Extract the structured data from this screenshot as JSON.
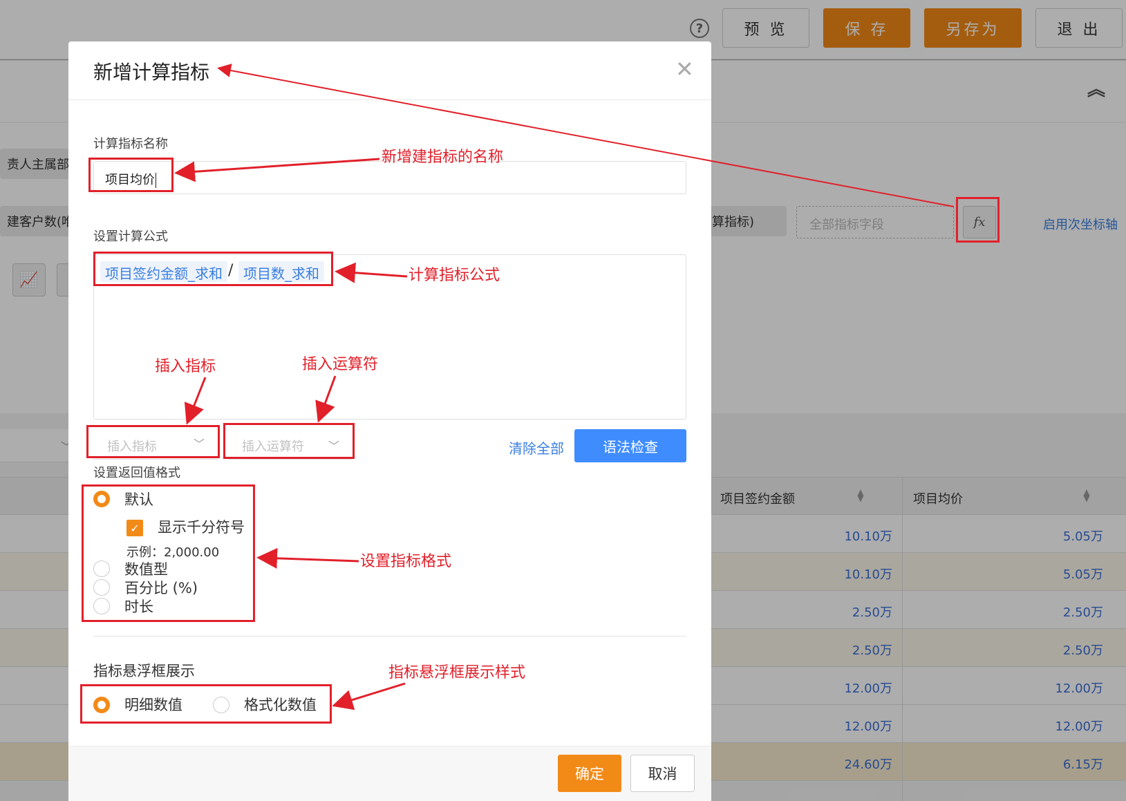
{
  "toolbar": {
    "preview": "预 览",
    "save": "保 存",
    "save_as": "另存为",
    "exit": "退 出"
  },
  "background": {
    "filter_chip_1": "责人主属部门",
    "filter_chip_2": "建客户数(唯一",
    "metric_chip": "算指标)",
    "all_fields_placeholder": "全部指标字段",
    "fx_label": "fx",
    "secondary_axis": "启用次坐标轴",
    "table_headers": [
      "项目签约金额",
      "项目均价"
    ],
    "table_rows": [
      {
        "amount": "10.10万",
        "avg": "5.05万"
      },
      {
        "amount": "10.10万",
        "avg": "5.05万"
      },
      {
        "amount": "2.50万",
        "avg": "2.50万"
      },
      {
        "amount": "2.50万",
        "avg": "2.50万"
      },
      {
        "amount": "12.00万",
        "avg": "12.00万"
      },
      {
        "amount": "12.00万",
        "avg": "12.00万"
      },
      {
        "amount": "24.60万",
        "avg": "6.15万"
      }
    ]
  },
  "modal": {
    "title": "新增计算指标",
    "name_label": "计算指标名称",
    "name_value": "项目均价",
    "formula_label": "设置计算公式",
    "formula_tokens": [
      "项目签约金额_求和",
      "/",
      "项目数_求和"
    ],
    "insert_metric_placeholder": "插入指标",
    "insert_operator_placeholder": "插入运算符",
    "clear_all": "清除全部",
    "syntax_check": "语法检查",
    "format_label": "设置返回值格式",
    "format_options": [
      "默认",
      "数值型",
      "百分比 (%)",
      "时长"
    ],
    "format_selected": "默认",
    "thousand_sep_label": "显示千分符号",
    "thousand_sep_checked": true,
    "example": "示例：2,000.00",
    "hover_label": "指标悬浮框展示",
    "hover_options": [
      "明细数值",
      "格式化数值"
    ],
    "hover_selected": "明细数值",
    "ok": "确定",
    "cancel": "取消"
  },
  "annotations": {
    "name": "新增建指标的名称",
    "formula": "计算指标公式",
    "insert_metric": "插入指标",
    "insert_operator": "插入运算符",
    "format": "设置指标格式",
    "hover": "指标悬浮框展示样式"
  },
  "colors": {
    "accent_orange": "#f28a17",
    "primary_blue": "#3f8cff",
    "annotation_red": "#e1202a",
    "link_blue": "#3a7fe0"
  }
}
